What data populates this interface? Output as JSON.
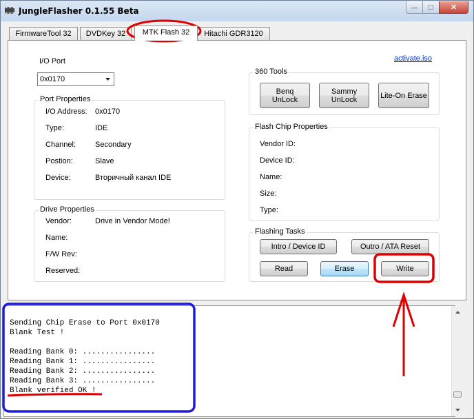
{
  "window": {
    "title": "JungleFlasher 0.1.55 Beta",
    "min_symbol": "—",
    "max_symbol": "□",
    "close_symbol": "✕"
  },
  "tabs": [
    {
      "label": "FirmwareTool 32"
    },
    {
      "label": "DVDKey 32"
    },
    {
      "label": "MTK Flash 32",
      "selected": true
    },
    {
      "label": "Hitachi GDR3120"
    }
  ],
  "io_port": {
    "label": "I/O Port",
    "value": "0x0170"
  },
  "activate_link": "activate.iso",
  "port_properties": {
    "legend": "Port Properties",
    "rows": [
      {
        "key": "I/O Address:",
        "value": "0x0170"
      },
      {
        "key": "Type:",
        "value": "IDE"
      },
      {
        "key": "Channel:",
        "value": "Secondary"
      },
      {
        "key": "Postion:",
        "value": "Slave"
      },
      {
        "key": "Device:",
        "value": "Вторичный канал IDE"
      }
    ]
  },
  "drive_properties": {
    "legend": "Drive Properties",
    "rows": [
      {
        "key": "Vendor:",
        "value": "Drive in Vendor Mode!"
      },
      {
        "key": "Name:",
        "value": ""
      },
      {
        "key": "F/W Rev:",
        "value": ""
      },
      {
        "key": "Reserved:",
        "value": ""
      }
    ]
  },
  "tools_360": {
    "legend": "360 Tools",
    "benq": "Benq\nUnLock",
    "sammy": "Sammy\nUnLock",
    "liteon": "Lite-On Erase"
  },
  "flash_chip": {
    "legend": "Flash Chip Properties",
    "rows": [
      "Vendor ID:",
      "Device ID:",
      "Name:",
      "Size:",
      "Type:"
    ]
  },
  "flashing_tasks": {
    "legend": "Flashing Tasks",
    "intro": "Intro / Device ID",
    "outro": "Outro / ATA Reset",
    "read": "Read",
    "erase": "Erase",
    "write": "Write"
  },
  "log": {
    "text": "Sending Chip Erase to Port 0x0170\nBlank Test !\n\nReading Bank 0: ................\nReading Bank 1: ................\nReading Bank 2: ................\nReading Bank 3: ................\nBlank verified OK !"
  },
  "annotation_colors": {
    "red": "#e00000",
    "blue": "#1d1dd8"
  }
}
